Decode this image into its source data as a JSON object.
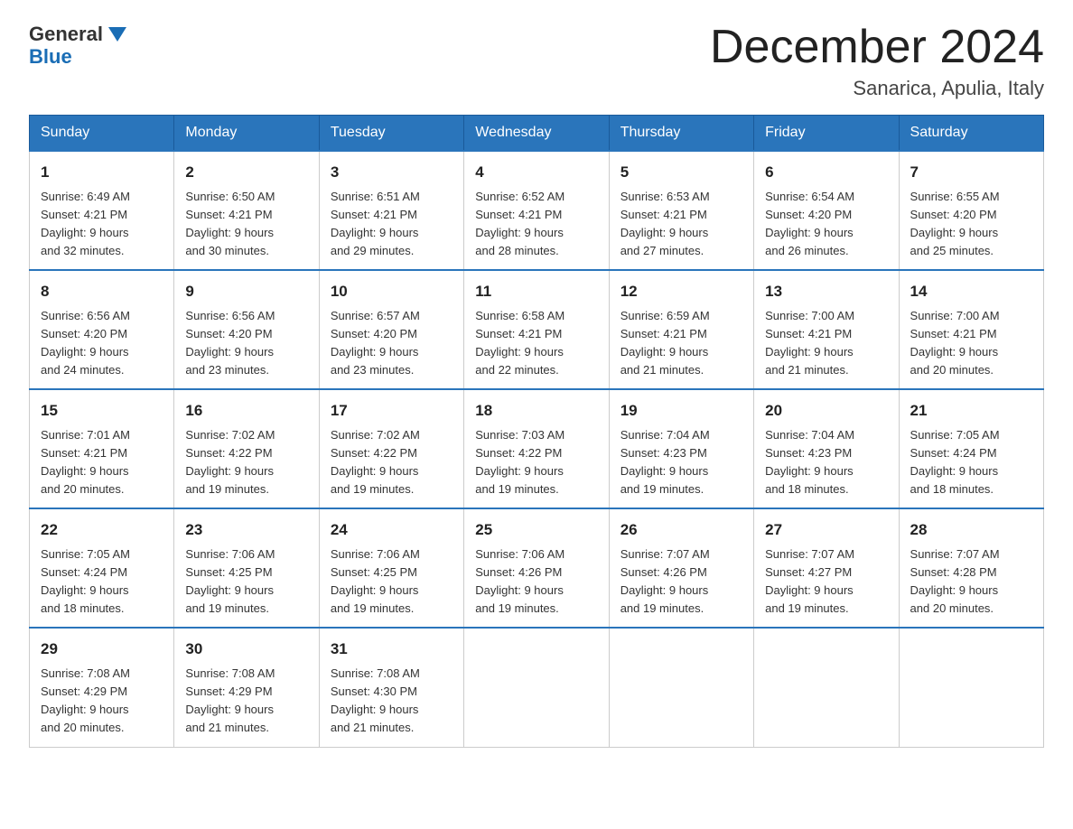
{
  "logo": {
    "general": "General",
    "blue": "Blue",
    "triangle": "▼"
  },
  "header": {
    "month": "December 2024",
    "location": "Sanarica, Apulia, Italy"
  },
  "days_of_week": [
    "Sunday",
    "Monday",
    "Tuesday",
    "Wednesday",
    "Thursday",
    "Friday",
    "Saturday"
  ],
  "weeks": [
    [
      {
        "day": 1,
        "sunrise": "6:49 AM",
        "sunset": "4:21 PM",
        "daylight": "9 hours and 32 minutes."
      },
      {
        "day": 2,
        "sunrise": "6:50 AM",
        "sunset": "4:21 PM",
        "daylight": "9 hours and 30 minutes."
      },
      {
        "day": 3,
        "sunrise": "6:51 AM",
        "sunset": "4:21 PM",
        "daylight": "9 hours and 29 minutes."
      },
      {
        "day": 4,
        "sunrise": "6:52 AM",
        "sunset": "4:21 PM",
        "daylight": "9 hours and 28 minutes."
      },
      {
        "day": 5,
        "sunrise": "6:53 AM",
        "sunset": "4:21 PM",
        "daylight": "9 hours and 27 minutes."
      },
      {
        "day": 6,
        "sunrise": "6:54 AM",
        "sunset": "4:20 PM",
        "daylight": "9 hours and 26 minutes."
      },
      {
        "day": 7,
        "sunrise": "6:55 AM",
        "sunset": "4:20 PM",
        "daylight": "9 hours and 25 minutes."
      }
    ],
    [
      {
        "day": 8,
        "sunrise": "6:56 AM",
        "sunset": "4:20 PM",
        "daylight": "9 hours and 24 minutes."
      },
      {
        "day": 9,
        "sunrise": "6:56 AM",
        "sunset": "4:20 PM",
        "daylight": "9 hours and 23 minutes."
      },
      {
        "day": 10,
        "sunrise": "6:57 AM",
        "sunset": "4:20 PM",
        "daylight": "9 hours and 23 minutes."
      },
      {
        "day": 11,
        "sunrise": "6:58 AM",
        "sunset": "4:21 PM",
        "daylight": "9 hours and 22 minutes."
      },
      {
        "day": 12,
        "sunrise": "6:59 AM",
        "sunset": "4:21 PM",
        "daylight": "9 hours and 21 minutes."
      },
      {
        "day": 13,
        "sunrise": "7:00 AM",
        "sunset": "4:21 PM",
        "daylight": "9 hours and 21 minutes."
      },
      {
        "day": 14,
        "sunrise": "7:00 AM",
        "sunset": "4:21 PM",
        "daylight": "9 hours and 20 minutes."
      }
    ],
    [
      {
        "day": 15,
        "sunrise": "7:01 AM",
        "sunset": "4:21 PM",
        "daylight": "9 hours and 20 minutes."
      },
      {
        "day": 16,
        "sunrise": "7:02 AM",
        "sunset": "4:22 PM",
        "daylight": "9 hours and 19 minutes."
      },
      {
        "day": 17,
        "sunrise": "7:02 AM",
        "sunset": "4:22 PM",
        "daylight": "9 hours and 19 minutes."
      },
      {
        "day": 18,
        "sunrise": "7:03 AM",
        "sunset": "4:22 PM",
        "daylight": "9 hours and 19 minutes."
      },
      {
        "day": 19,
        "sunrise": "7:04 AM",
        "sunset": "4:23 PM",
        "daylight": "9 hours and 19 minutes."
      },
      {
        "day": 20,
        "sunrise": "7:04 AM",
        "sunset": "4:23 PM",
        "daylight": "9 hours and 18 minutes."
      },
      {
        "day": 21,
        "sunrise": "7:05 AM",
        "sunset": "4:24 PM",
        "daylight": "9 hours and 18 minutes."
      }
    ],
    [
      {
        "day": 22,
        "sunrise": "7:05 AM",
        "sunset": "4:24 PM",
        "daylight": "9 hours and 18 minutes."
      },
      {
        "day": 23,
        "sunrise": "7:06 AM",
        "sunset": "4:25 PM",
        "daylight": "9 hours and 19 minutes."
      },
      {
        "day": 24,
        "sunrise": "7:06 AM",
        "sunset": "4:25 PM",
        "daylight": "9 hours and 19 minutes."
      },
      {
        "day": 25,
        "sunrise": "7:06 AM",
        "sunset": "4:26 PM",
        "daylight": "9 hours and 19 minutes."
      },
      {
        "day": 26,
        "sunrise": "7:07 AM",
        "sunset": "4:26 PM",
        "daylight": "9 hours and 19 minutes."
      },
      {
        "day": 27,
        "sunrise": "7:07 AM",
        "sunset": "4:27 PM",
        "daylight": "9 hours and 19 minutes."
      },
      {
        "day": 28,
        "sunrise": "7:07 AM",
        "sunset": "4:28 PM",
        "daylight": "9 hours and 20 minutes."
      }
    ],
    [
      {
        "day": 29,
        "sunrise": "7:08 AM",
        "sunset": "4:29 PM",
        "daylight": "9 hours and 20 minutes."
      },
      {
        "day": 30,
        "sunrise": "7:08 AM",
        "sunset": "4:29 PM",
        "daylight": "9 hours and 21 minutes."
      },
      {
        "day": 31,
        "sunrise": "7:08 AM",
        "sunset": "4:30 PM",
        "daylight": "9 hours and 21 minutes."
      },
      null,
      null,
      null,
      null
    ]
  ],
  "labels": {
    "sunrise": "Sunrise:",
    "sunset": "Sunset:",
    "daylight": "Daylight:"
  }
}
